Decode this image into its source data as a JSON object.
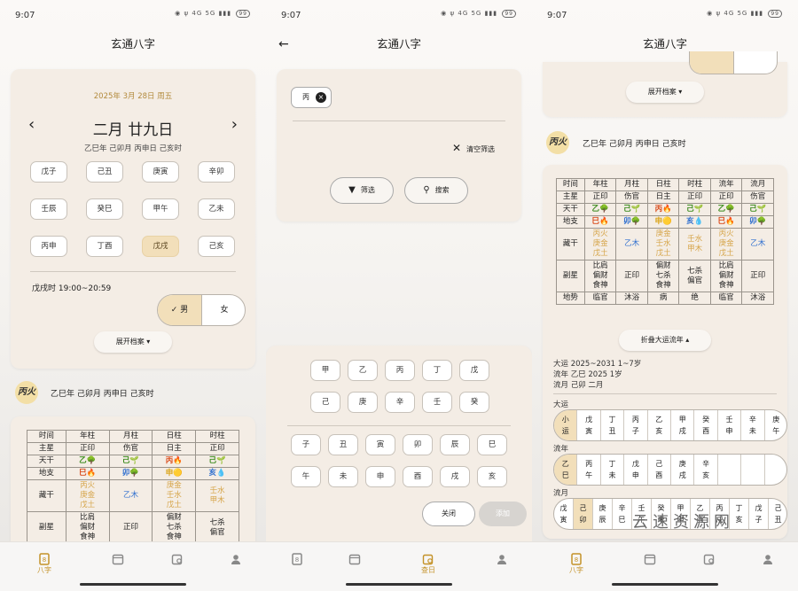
{
  "status": {
    "time": "9:07",
    "battery": "99",
    "network": "4G 5G"
  },
  "app_title": "玄通八字",
  "p1": {
    "date_line": "2025年 3月 28日 周五",
    "lunar": "二月 廿九日",
    "ganzhi": "乙巳年 己卯月 丙申日 己亥时",
    "hours": [
      "戊子",
      "己丑",
      "庚寅",
      "辛卯",
      "壬辰",
      "癸巳",
      "甲午",
      "乙未",
      "丙申",
      "丁酉",
      "戊戌",
      "己亥"
    ],
    "hour_text": "戊戌时 19:00~20:59",
    "male": "男",
    "female": "女",
    "expand": "展开档案",
    "daymaster": "丙火",
    "daymaster_gz": "乙巳年 己卯月 丙申日 己亥时"
  },
  "p2": {
    "chip": "丙",
    "clear": "清空筛选",
    "filter": "筛选",
    "search": "搜索",
    "stems": [
      "甲",
      "乙",
      "丙",
      "丁",
      "戊",
      "己",
      "庚",
      "辛",
      "壬",
      "癸"
    ],
    "branches": [
      "子",
      "丑",
      "寅",
      "卯",
      "辰",
      "巳",
      "午",
      "未",
      "申",
      "酉",
      "戌",
      "亥"
    ],
    "close": "关闭",
    "add": "添加"
  },
  "p3": {
    "expand": "展开档案",
    "daymaster": "丙火",
    "daymaster_gz": "乙巳年 己卯月 丙申日 己亥时",
    "collapse": "折叠大运流年",
    "dayun_info": "大运 2025~2031 1~7岁",
    "liunian_info": "流年 乙巳 2025 1岁",
    "liuyue_info": "流月 己卯 二月",
    "dayun_label": "大运",
    "liunian_label": "流年",
    "liuyue_label": "流月",
    "dayun_cells": [
      "小运",
      "戊寅",
      "丁丑",
      "丙子",
      "乙亥",
      "甲戌",
      "癸酉",
      "壬申",
      "辛未",
      "庚午"
    ],
    "liunian_cells": [
      "乙巳",
      "丙午",
      "丁未",
      "戊申",
      "己酉",
      "庚戌",
      "辛亥",
      "",
      "",
      ""
    ],
    "liuyue_cells": [
      "戊寅",
      "己卯",
      "庚辰",
      "辛巳",
      "壬午",
      "癸未",
      "甲申",
      "乙酉",
      "丙戌",
      "丁亥",
      "戊子",
      "己丑"
    ]
  },
  "bazi": {
    "headers": [
      "时间",
      "年柱",
      "月柱",
      "日柱",
      "时柱"
    ],
    "headers_ext": [
      "时间",
      "年柱",
      "月柱",
      "日柱",
      "时柱",
      "流年",
      "流月"
    ],
    "zhuxing": [
      "主星",
      "正印",
      "伤官",
      "日主",
      "正印"
    ],
    "zhuxing_ext": [
      "主星",
      "正印",
      "伤官",
      "日主",
      "正印",
      "正印",
      "伤官"
    ],
    "tiangan": [
      "天干",
      "乙🌳",
      "己🌱",
      "丙🔥",
      "己🌱"
    ],
    "tiangan_ext": [
      "天干",
      "乙🌳",
      "己🌱",
      "丙🔥",
      "己🌱",
      "乙🌳",
      "己🌱"
    ],
    "dizhi": [
      "地支",
      "巳🔥",
      "卯🌳",
      "申🟡",
      "亥💧"
    ],
    "dizhi_ext": [
      "地支",
      "巳🔥",
      "卯🌳",
      "申🟡",
      "亥💧",
      "巳🔥",
      "卯🌳"
    ],
    "canggan_label": "藏干",
    "canggan": [
      "丙火 庚金 戊土",
      "乙木",
      "庚金 壬水 戊土",
      "壬水 甲木"
    ],
    "canggan_ext": [
      "丙火 庚金 戊土",
      "乙木",
      "庚金 壬水 戊土",
      "壬水 甲木",
      "丙火 庚金 戊土",
      "乙木"
    ],
    "fuxing_label": "副星",
    "fuxing": [
      "比肩 偏财 食神",
      "正印",
      "偏财 七杀 食神",
      "七杀 偏官"
    ],
    "fuxing_ext": [
      "比肩 偏财 食神",
      "正印",
      "偏财 七杀 食神",
      "七杀 偏官",
      "比肩 偏财 食神",
      "正印"
    ],
    "dishi": [
      "地势",
      "临官",
      "沐浴",
      "病",
      "绝",
      "临官",
      "沐浴"
    ]
  },
  "nav": [
    "八字",
    "",
    "查日",
    ""
  ],
  "watermark": "云速资源网"
}
